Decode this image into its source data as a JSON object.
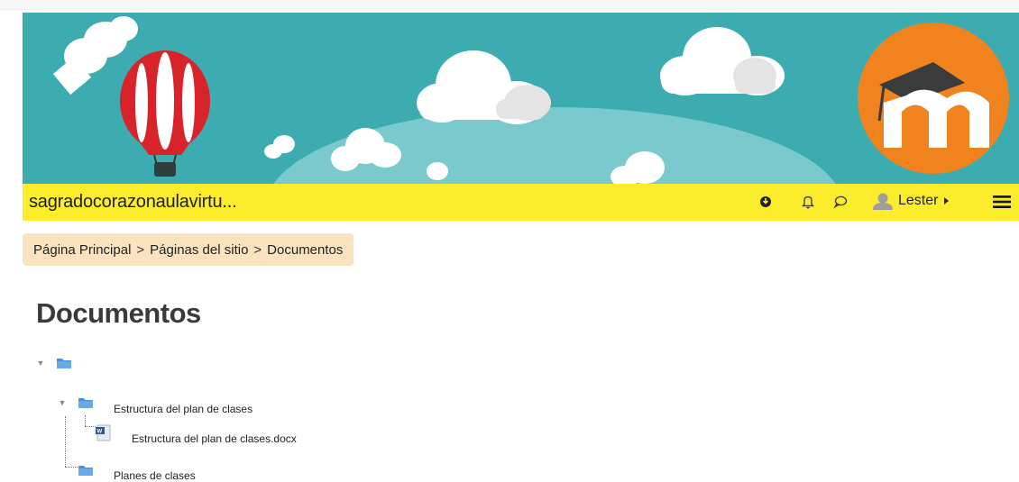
{
  "header": {
    "site_name": "sagradocorazonaulavirtu...",
    "user_name": "Lester",
    "colors": {
      "banner": "#3cacb1",
      "navbar": "#fbec2c",
      "breadcrumb_bg": "#fbe3bf",
      "logo_orange": "#f0831e"
    },
    "icons": [
      "download-circle-icon",
      "bell-icon",
      "chat-bubble-icon",
      "user-avatar-icon",
      "caret-right-icon",
      "hamburger-menu-icon"
    ]
  },
  "breadcrumb": {
    "items": [
      "Página Principal",
      "Páginas del sitio",
      "Documentos"
    ],
    "separator": ">"
  },
  "page": {
    "title": "Documentos"
  },
  "tree": {
    "root_label": "",
    "folder1": "Estructura del plan de clases",
    "file1": "Estructura del plan de clases.docx",
    "folder2": "Planes de clases"
  }
}
